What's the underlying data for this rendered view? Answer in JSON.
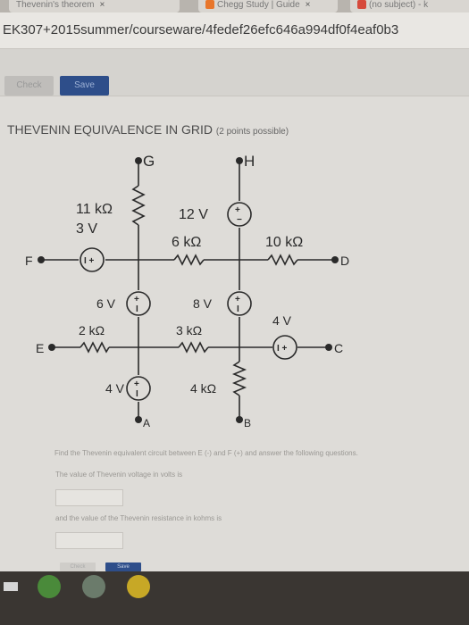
{
  "browser": {
    "tabs": [
      {
        "label": "Thevenin's theorem",
        "close": "×"
      },
      {
        "label": "Chegg Study | Guide",
        "close": "×"
      },
      {
        "label": "(no subject) - k",
        "close": ""
      }
    ],
    "url": "EK307+2015summer/courseware/4fedef26efc646a994df0f4eaf0b3"
  },
  "toolbar": {
    "check_label": "Check",
    "save_label": "Save"
  },
  "question": {
    "title": "THEVENIN EQUIVALENCE IN GRID",
    "points": "(2 points possible)",
    "prompt1": "Find the Thevenin equivalent circuit between E (-) and F (+) and answer the following questions.",
    "prompt2": "The value of Thevenin voltage in volts is",
    "prompt3": "and the value of the Thevenin resistance in kohms is",
    "answer1": "",
    "answer2": ""
  },
  "circuit": {
    "node_G": "G",
    "node_H": "H",
    "node_F": "F",
    "node_D": "D",
    "node_E": "E",
    "node_C": "C",
    "node_A": "A",
    "node_B": "B",
    "r_11k": "11 kΩ",
    "v_3v": "3 V",
    "v_12v": "12 V",
    "r_6k": "6 kΩ",
    "r_10k": "10 kΩ",
    "v_6v": "6 V",
    "v_8v": "8 V",
    "r_2k": "2 kΩ",
    "r_3k": "3 kΩ",
    "v_4v_right": "4 V",
    "v_4v_bottom": "4 V",
    "r_4k": "4 kΩ"
  },
  "buttons_bottom": {
    "check": "Check",
    "save": "Save"
  },
  "colors": {
    "blue": "#2e4e8a",
    "page_bg": "#dedcd8",
    "text": "#4d4d4d"
  }
}
